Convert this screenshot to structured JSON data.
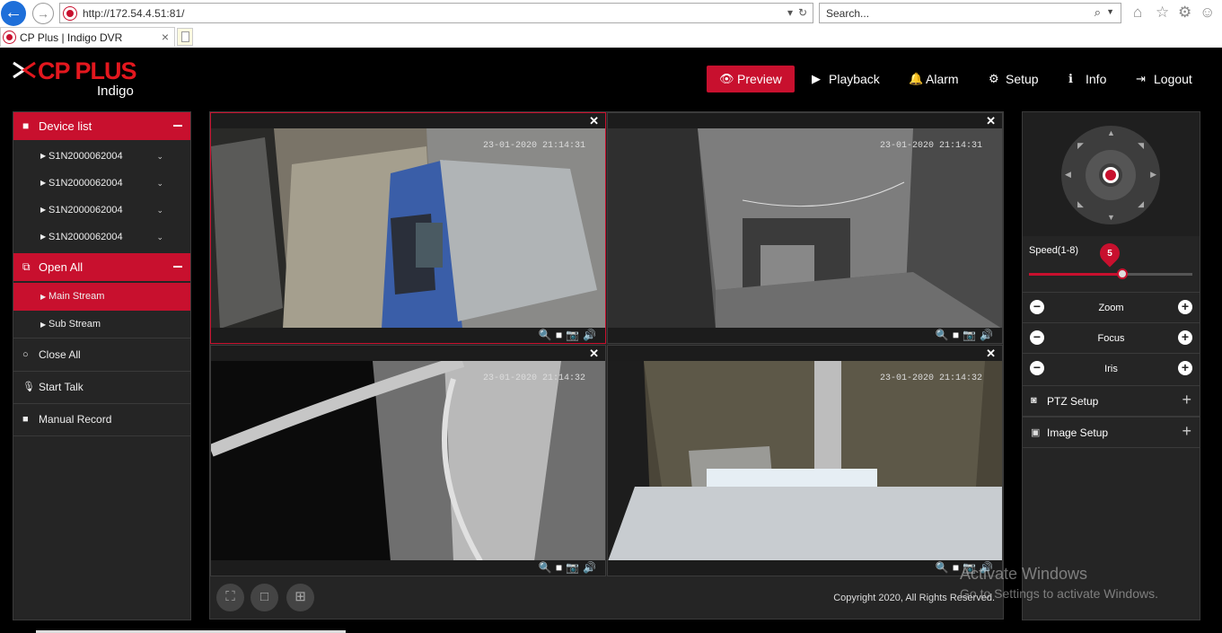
{
  "browser": {
    "url": "http://172.54.4.51:81/",
    "search_placeholder": "Search...",
    "tab_title": "CP Plus | Indigo DVR"
  },
  "app": {
    "brand": "CP PLUS",
    "brand_sub": "Indigo",
    "nav": [
      {
        "label": "Preview",
        "icon": "eye-icon",
        "active": true
      },
      {
        "label": "Playback",
        "icon": "play-circle-icon"
      },
      {
        "label": "Alarm",
        "icon": "bell-icon"
      },
      {
        "label": "Setup",
        "icon": "gear-icon"
      },
      {
        "label": "Info",
        "icon": "info-icon"
      },
      {
        "label": "Logout",
        "icon": "logout-icon"
      }
    ]
  },
  "sidebar": {
    "device_list_label": "Device list",
    "devices": [
      "S1N2000062004",
      "S1N2000062004",
      "S1N2000062004",
      "S1N2000062004"
    ],
    "open_all_label": "Open All",
    "streams": [
      {
        "label": "Main Stream",
        "active": true
      },
      {
        "label": "Sub Stream",
        "active": false
      }
    ],
    "actions": [
      {
        "label": "Close All",
        "icon": "circle-icon"
      },
      {
        "label": "Start Talk",
        "icon": "microphone-icon"
      },
      {
        "label": "Manual Record",
        "icon": "video-camera-icon"
      }
    ]
  },
  "video": {
    "cells": [
      {
        "timestamp": "23-01-2020 21:14:31",
        "selected": true
      },
      {
        "timestamp": "23-01-2020 21:14:31",
        "selected": false
      },
      {
        "timestamp": "23-01-2020 21:14:32",
        "selected": false
      },
      {
        "timestamp": "23-01-2020 21:14:32",
        "selected": false
      }
    ],
    "copyright": "Copyright 2020, All Rights Reserved."
  },
  "ptz": {
    "speed_label": "Speed(1-8)",
    "speed_value": 5,
    "speed_min": 1,
    "speed_max": 8,
    "zoom_label": "Zoom",
    "focus_label": "Focus",
    "iris_label": "Iris",
    "ptz_setup_label": "PTZ Setup",
    "image_setup_label": "Image Setup"
  },
  "watermark": {
    "line1": "Activate Windows",
    "line2": "Go to Settings to activate Windows."
  },
  "colors": {
    "accent": "#c8102e",
    "panel": "#252525",
    "background": "#000000"
  }
}
